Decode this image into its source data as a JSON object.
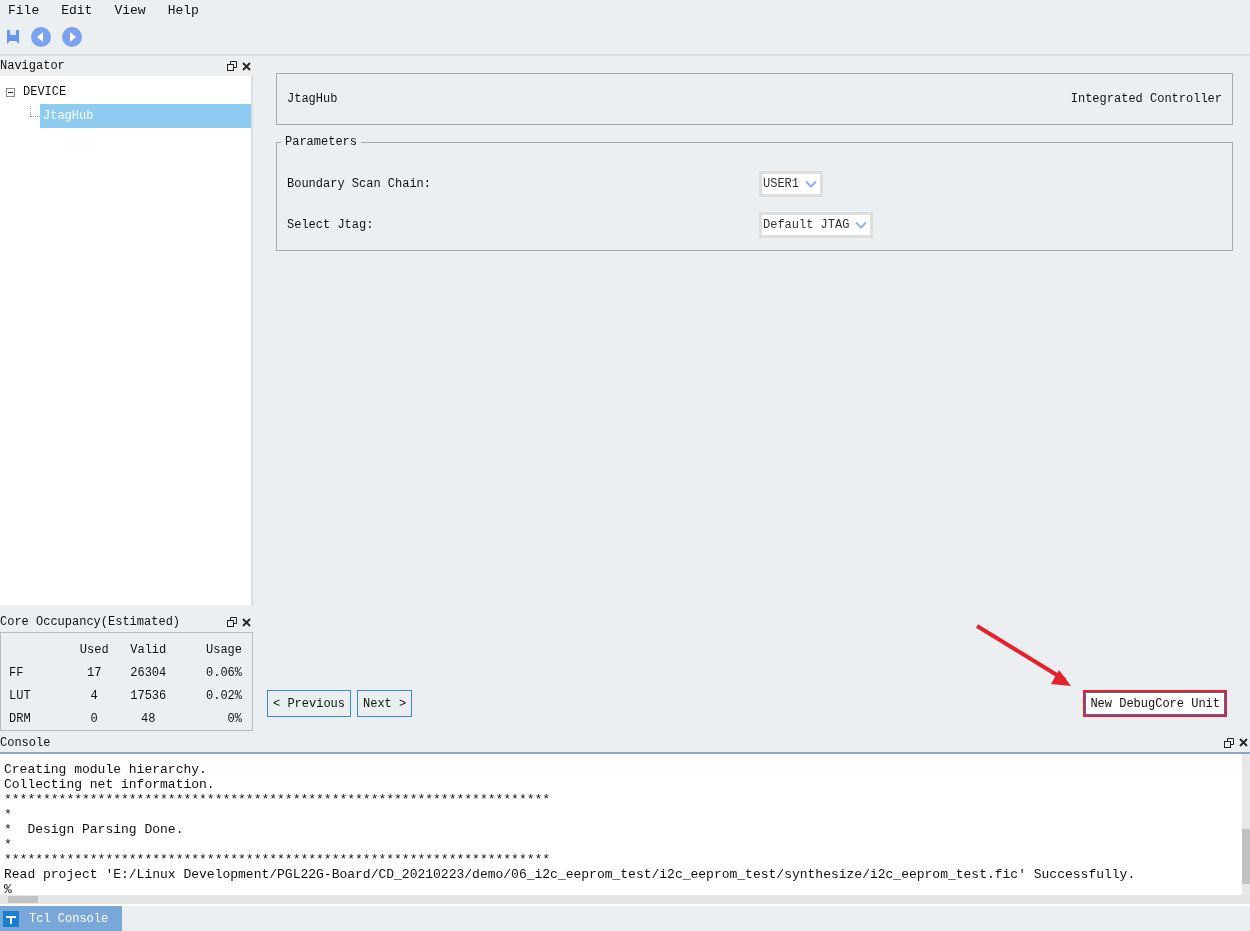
{
  "menu": [
    "File",
    "Edit",
    "View",
    "Help"
  ],
  "navigator": {
    "title": "Navigator",
    "tree": [
      {
        "label": "DEVICE",
        "expanded": true,
        "selected": false,
        "children": [
          {
            "label": "JtagHub",
            "selected": true
          }
        ]
      }
    ]
  },
  "core_occupancy": {
    "title": "Core Occupancy(Estimated)",
    "columns": [
      "Used",
      "Valid",
      "Usage"
    ],
    "rows": [
      {
        "name": "FF",
        "used": "17",
        "valid": "26304",
        "usage": "0.06%"
      },
      {
        "name": "LUT",
        "used": "4",
        "valid": "17536",
        "usage": "0.02%"
      },
      {
        "name": "DRM",
        "used": "0",
        "valid": "48",
        "usage": "0%"
      }
    ]
  },
  "header_card": {
    "name": "JtagHub",
    "type": "Integrated Controller"
  },
  "parameters": {
    "title": "Parameters",
    "fields": [
      {
        "label": "Boundary Scan Chain:",
        "value": "USER1"
      },
      {
        "label": "Select Jtag:",
        "value": "Default JTAG"
      }
    ]
  },
  "buttons": [
    {
      "label": "< Previous",
      "highlighted": false
    },
    {
      "label": "Next >",
      "highlighted": false
    }
  ],
  "action_button": {
    "label": "New DebugCore Unit",
    "highlighted": true
  },
  "console": {
    "title": "Console",
    "lines": [
      "Creating module hierarchy.",
      "Collecting net information.",
      "**********************************************************************",
      "*",
      "*  Design Parsing Done.",
      "*",
      "**********************************************************************",
      "Read project 'E:/Linux Development/PGL22G-Board/CD_20210223/demo/06_i2c_eeprom_test/i2c_eeprom_test/synthesize/i2c_eeprom_test.fic' Successfully.",
      "%"
    ]
  },
  "bottom_tabs": [
    {
      "label": "Tcl Console",
      "selected": true
    }
  ]
}
